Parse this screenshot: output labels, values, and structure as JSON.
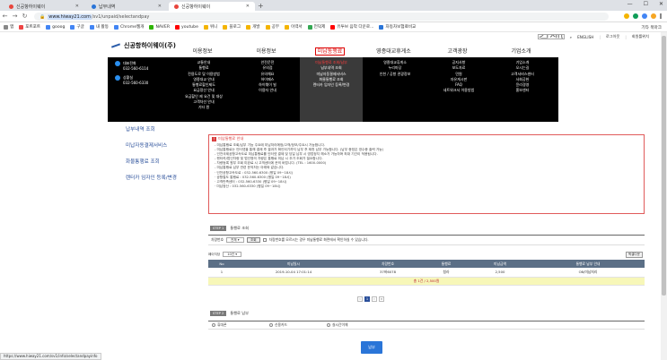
{
  "browser": {
    "tabs": [
      {
        "title": "신공항하이웨이",
        "active": false
      },
      {
        "title": "납부내역",
        "active": false
      },
      {
        "title": "신공항하이웨이",
        "active": true
      }
    ],
    "url_host": "hiway21.com",
    "url_path": "/sv1/unpaid/selectandpay",
    "url_prefix": "www.",
    "bookmarks": [
      "앱",
      "포트포트",
      "gooog",
      "구글",
      "내 활동",
      "Chrome웹개",
      "NAVER",
      "youtube",
      "위니",
      "블로그",
      "개발",
      "공부",
      "이력서",
      "언덕제",
      "유투브 음악 다운로...",
      "자동차보험료비교"
    ],
    "other_bookmarks": "기타 북마크",
    "status_url": "https://www.hiway21.com/sv1/info/selectandpayinfo"
  },
  "site": {
    "logo_text": "신공항하이웨이(주)",
    "util": {
      "search_placeholder": "검색어를 입력하세요",
      "english": "ENGLISH",
      "login": "로그아웃",
      "sitemap": "회원를위치"
    },
    "gnb": [
      {
        "label": "이용정보",
        "active": false
      },
      {
        "label": "이용정보",
        "active": false
      },
      {
        "label": "미납통행료",
        "active": true
      },
      {
        "label": "영종대교휴게소",
        "active": false
      },
      {
        "label": "고객광장",
        "active": false
      },
      {
        "label": "기업소개",
        "active": false
      }
    ],
    "contacts": [
      {
        "label": "대표전화",
        "number": "032-560-6114"
      },
      {
        "label": "상황실",
        "number": "032-560-6330"
      }
    ],
    "mega": [
      [
        "교통안내",
        "통행료",
        "전용도로 및 이용방법",
        "영종대교 안내",
        "통행료할인제도",
        "요금정산 안내",
        "요금할인 제 요건 및 대상",
        "고객차선 안내",
        "기타 원"
      ],
      [
        "안전운전",
        "유의점",
        "유의해요",
        "하이패스",
        "하이웨이 빌",
        "이용자 안내"
      ],
      [
        "미납통행료 조회/납부",
        "납부내역 조회",
        "미납자동결제서비스",
        "화물통행료 조회",
        "렌터카 임자인 등록/변경"
      ],
      [
        "영종대교휴게소",
        "누리마당",
        "인천 / 공항 관광정보"
      ],
      [
        "공지사항",
        "보도자료",
        "민원",
        "자유게시판",
        "FAQ",
        "네트워크서 이용방법"
      ],
      [
        "기업소개",
        "오시는길",
        "고객서비스센터",
        "사회공헌",
        "윤리경영",
        "홍보센터"
      ]
    ],
    "left_menu": [
      "납부내역 조회",
      "미납자동결제서비스",
      "화물통행료 조회",
      "렌터카 임자인 등록/변경"
    ]
  },
  "notice": {
    "title": "미납통행료 안내",
    "lines": [
      "- 미납통행료 조회/납부 기능 주요에 미납처리예정/고객/정보/주요시 가능합니다.",
      "- 미납통행료는 인터넷을 통해 결제 후 결과가 확인되기까지 납부 후 제휴 납부 가능합니다. (납부 증빙은 영수증 출력 가능)",
      "- 인천국제공항고속도로 미납통행료를 인터넷 결제 및 당일 납부 시 영업정지 해소가 가능하며 최대 기간이 적용됩니다.",
      "- 렌터카/법인차량 및 법인명의 차량은 통행료 미납 시 추가 조회가 필요합니다.",
      "- 차량등록 원부 조회 미완료 시 고객센터에 문의 바랍니다. (TEL : 1600-0000)",
      "- 미납통행료 납부 관련 문의처는 아래와 같습니다.",
      "   · 인천공항고속도로 : 032-560-6300 (평일 09~18시)",
      "   · 공항철도 통행료 : 032-560-6300 (평일 09~18시)",
      "   · 고객만족센터 : 032-560-6330 (평일 09~18시)",
      "   · 미납정산 : 032-560-6330 (평일 09~18시)"
    ]
  },
  "step1": {
    "badge": "STEP 1",
    "title": "통행료 조회",
    "vehicle_label": "차량번호",
    "vehicle_select": "전체",
    "search_btn": "조회",
    "note": "차량번호를 모르시는 경우 미납통행료 화면에서 확인하실 수 있습니다."
  },
  "list": {
    "page_size_label": "페이지당",
    "page_size": "10건",
    "excel_btn": "엑셀다운",
    "columns": [
      "No",
      "미납일시",
      "차량번호",
      "통행료",
      "미납금액",
      "통행료 납부 안내"
    ],
    "rows": [
      [
        "1",
        "2019-10-04 17:01:14",
        "37바6078",
        "청라",
        "2,500",
        "OB/미납처리"
      ]
    ],
    "summary": "총 1건 / 2,500원",
    "pages": [
      "‹",
      "1",
      "›",
      "»"
    ]
  },
  "step2": {
    "badge": "STEP 2",
    "title": "통행료 납부",
    "methods": [
      "휴대폰",
      "신용카드",
      "실시간이체"
    ]
  },
  "pay_button": "납부"
}
